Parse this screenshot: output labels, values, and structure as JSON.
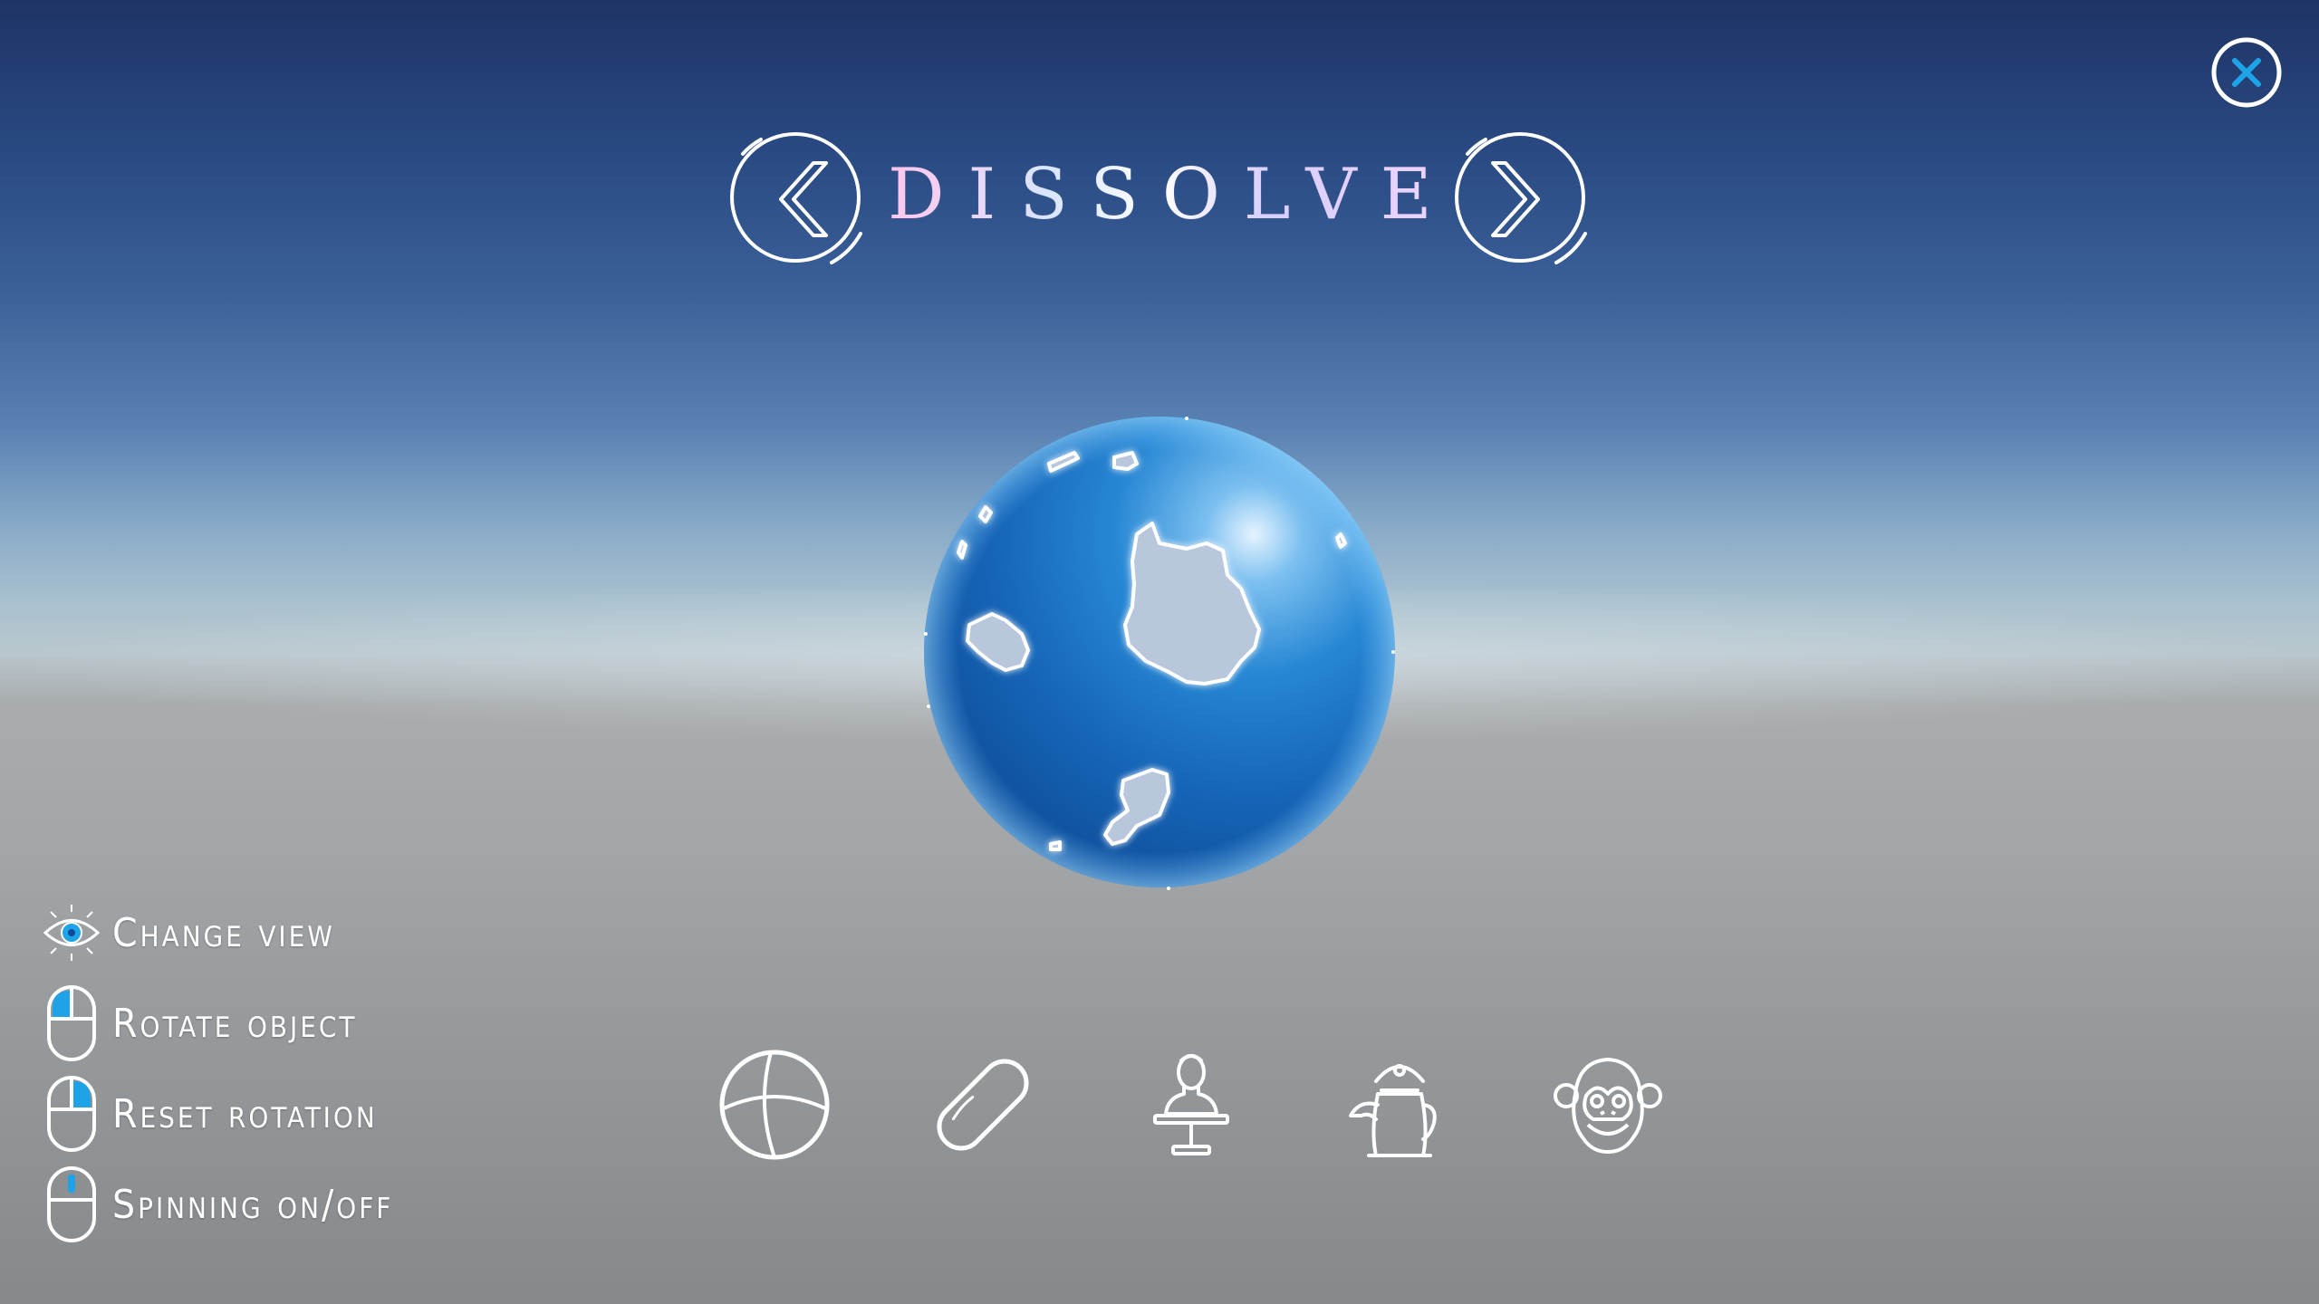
{
  "header": {
    "title": "DISSOLVE",
    "prev_icon": "chevron-left-icon",
    "next_icon": "chevron-right-icon",
    "close_icon": "close-icon"
  },
  "controls": [
    {
      "icon": "eye-icon",
      "label": "Change view"
    },
    {
      "icon": "mouse-left-button-icon",
      "label": "Rotate object"
    },
    {
      "icon": "mouse-right-button-icon",
      "label": "Reset rotation"
    },
    {
      "icon": "mouse-middle-button-icon",
      "label": "Spinning on/off"
    }
  ],
  "models": [
    {
      "icon": "sphere-icon"
    },
    {
      "icon": "capsule-icon"
    },
    {
      "icon": "bust-icon"
    },
    {
      "icon": "teapot-icon"
    },
    {
      "icon": "monkey-icon"
    }
  ],
  "colors": {
    "accent": "#1fa3e8",
    "sphere": "#1b6fc4",
    "sky_top": "#1e3466",
    "ground": "#a3a6a8"
  }
}
